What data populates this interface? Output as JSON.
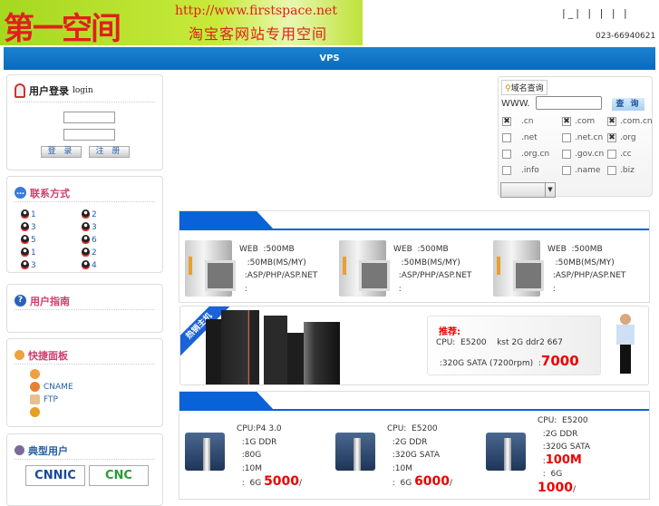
{
  "header": {
    "logo": "第一空间",
    "url": "http://www.firstspace.net",
    "slogan": "淘宝客网站专用空间",
    "top_links": "|_| | | | |",
    "phone": "023-66940621"
  },
  "nav": {
    "item": "VPS"
  },
  "login": {
    "title": "用户登录",
    "title_en": "login",
    "login_btn": "登 录",
    "register_btn": "注 册"
  },
  "contact": {
    "title": "联系方式",
    "qq": [
      "1",
      "2",
      "3",
      "3",
      "5",
      "6",
      "1",
      "2",
      "3",
      "4"
    ]
  },
  "guide": {
    "title": "用户指南"
  },
  "quick": {
    "title": "快捷面板",
    "items": [
      "",
      "CNAME",
      "FTP",
      ""
    ]
  },
  "users": {
    "title": "典型用户",
    "logos": [
      "CNNIC",
      "CNC"
    ]
  },
  "domain": {
    "title": "域名查询",
    "prefix": "WWW.",
    "search_btn": "查 询",
    "options": [
      {
        "label": ".cn",
        "checked": true
      },
      {
        "label": ".com",
        "checked": true
      },
      {
        "label": ".com.cn",
        "checked": true
      },
      {
        "label": ".net",
        "checked": false
      },
      {
        "label": ".net.cn",
        "checked": false
      },
      {
        "label": ".org",
        "checked": true
      },
      {
        "label": ".org.cn",
        "checked": false
      },
      {
        "label": ".gov.cn",
        "checked": false
      },
      {
        "label": ".cc",
        "checked": false
      },
      {
        "label": ".info",
        "checked": false
      },
      {
        "label": ".name",
        "checked": false
      },
      {
        "label": ".biz",
        "checked": false
      }
    ]
  },
  "hosting": {
    "products": [
      {
        "lines": "WEB  :500MB\n   :50MB(MS/MY)\n  :ASP/PHP/ASP.NET\n  :"
      },
      {
        "lines": "WEB  :500MB\n   :50MB(MS/MY)\n  :ASP/PHP/ASP.NET\n  :"
      },
      {
        "lines": "WEB  :500MB\n   :50MB(MS/MY)\n  :ASP/PHP/ASP.NET\n  :"
      }
    ]
  },
  "hot": {
    "ribbon": "热销主机",
    "title": "推荐:",
    "line1": "CPU:  E5200    kst 2G ddr2 667",
    "line2": " :320G SATA (7200rpm)  :",
    "price": "7000"
  },
  "servers": [
    {
      "lines": "CPU:P4 3.0\n  :1G DDR\n  :80G\n  :10M\n  :  6G",
      "price": "5000",
      "unit": "/"
    },
    {
      "lines": "CPU:  E5200\n  :2G DDR\n  :320G SATA\n  :10M\n  :  6G",
      "price": "6000",
      "unit": "/"
    },
    {
      "lines": "CPU:  E5200\n  :2G DDR\n  :320G SATA",
      "bw": "100M",
      "line5": "  :  6G",
      "price": "1000",
      "unit": "/"
    }
  ]
}
